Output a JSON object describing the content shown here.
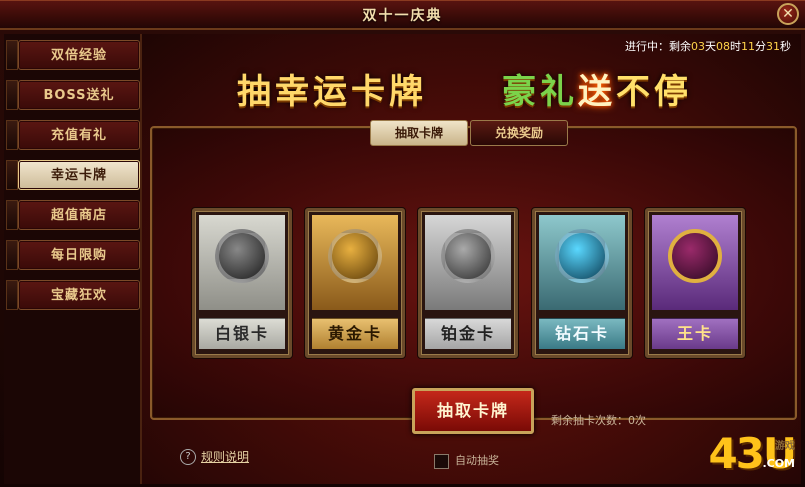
{
  "window": {
    "title": "双十一庆典",
    "close_label": "✕"
  },
  "sidebar": {
    "items": [
      {
        "label": "双倍经验",
        "active": false
      },
      {
        "label": "BOSS送礼",
        "active": false
      },
      {
        "label": "充值有礼",
        "active": false
      },
      {
        "label": "幸运卡牌",
        "active": true
      },
      {
        "label": "超值商店",
        "active": false
      },
      {
        "label": "每日限购",
        "active": false
      },
      {
        "label": "宝藏狂欢",
        "active": false
      }
    ]
  },
  "countdown": {
    "prefix": "进行中：剩余",
    "days": "03",
    "d": "天",
    "hours": "08",
    "h": "时",
    "minutes": "11",
    "m": "分",
    "seconds": "31",
    "s": "秒"
  },
  "headline": {
    "left": "抽幸运卡牌",
    "right_a": "豪礼",
    "right_b": "送",
    "right_c": "不停"
  },
  "tabs": [
    {
      "label": "抽取卡牌"
    },
    {
      "label": "兑换奖励"
    }
  ],
  "cards": [
    {
      "label": "白银卡"
    },
    {
      "label": "黄金卡"
    },
    {
      "label": "铂金卡"
    },
    {
      "label": "钻石卡"
    },
    {
      "label": "王卡"
    }
  ],
  "draw_button": "抽取卡牌",
  "remaining_text": "剩余抽卡次数：0次",
  "rules_icon": "?",
  "rules_link": "规则说明",
  "auto_draw": "自动抽奖",
  "logo": {
    "digits": "43U",
    "domain": ".COM",
    "tag": "游戏"
  },
  "colors": {
    "accent_gold": "#ffd86a",
    "frame_red": "#4a0c08"
  }
}
